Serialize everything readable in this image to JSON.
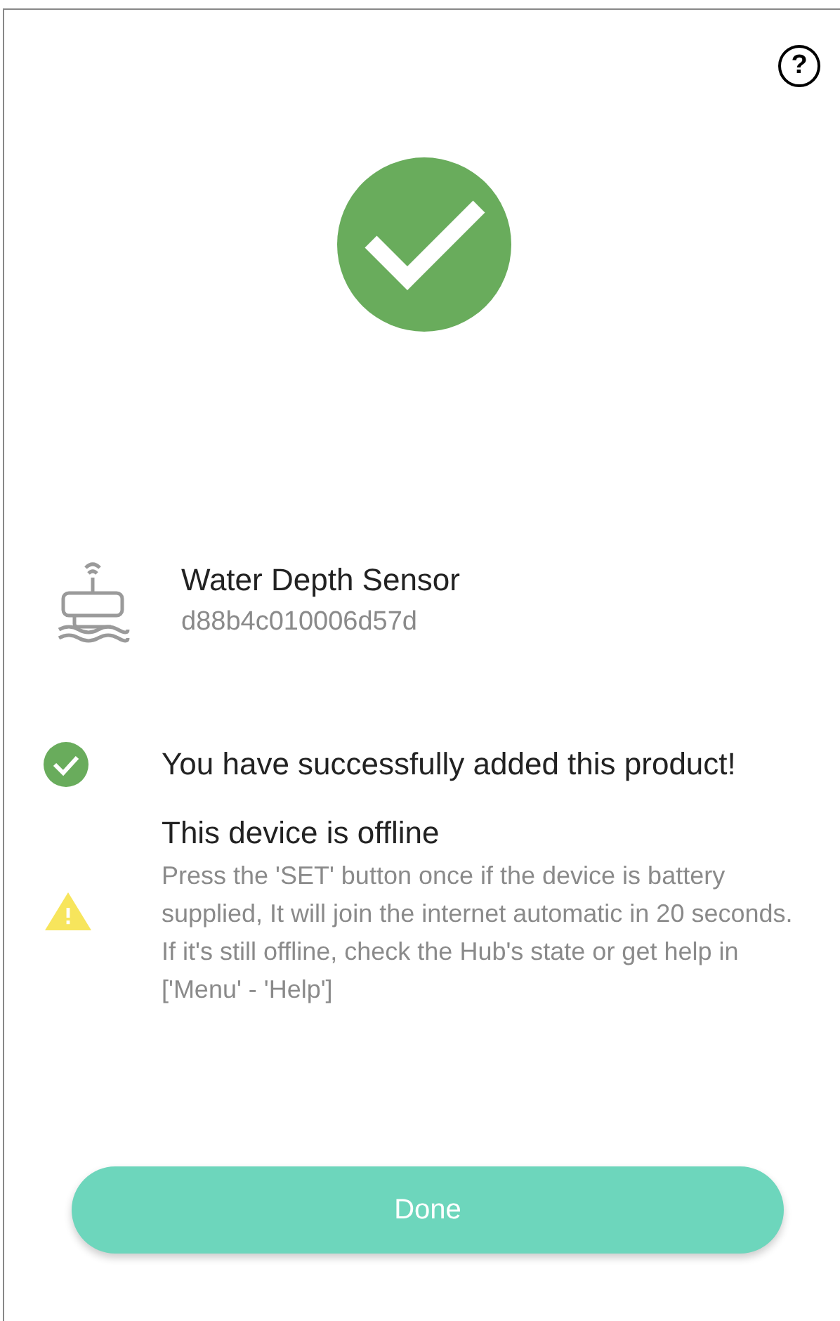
{
  "help_button": {
    "label": "?"
  },
  "device": {
    "name": "Water Depth Sensor",
    "id": "d88b4c010006d57d"
  },
  "messages": [
    {
      "kind": "success",
      "title": "You have successfully added this product!"
    },
    {
      "kind": "warning",
      "title": "This device is offline",
      "detail": "Press the 'SET' button once if the device is battery supplied, It will join the internet automatic in 20 seconds. If it's still offline, check the Hub's state or get help in ['Menu' - 'Help']"
    }
  ],
  "done_button": {
    "label": "Done"
  }
}
